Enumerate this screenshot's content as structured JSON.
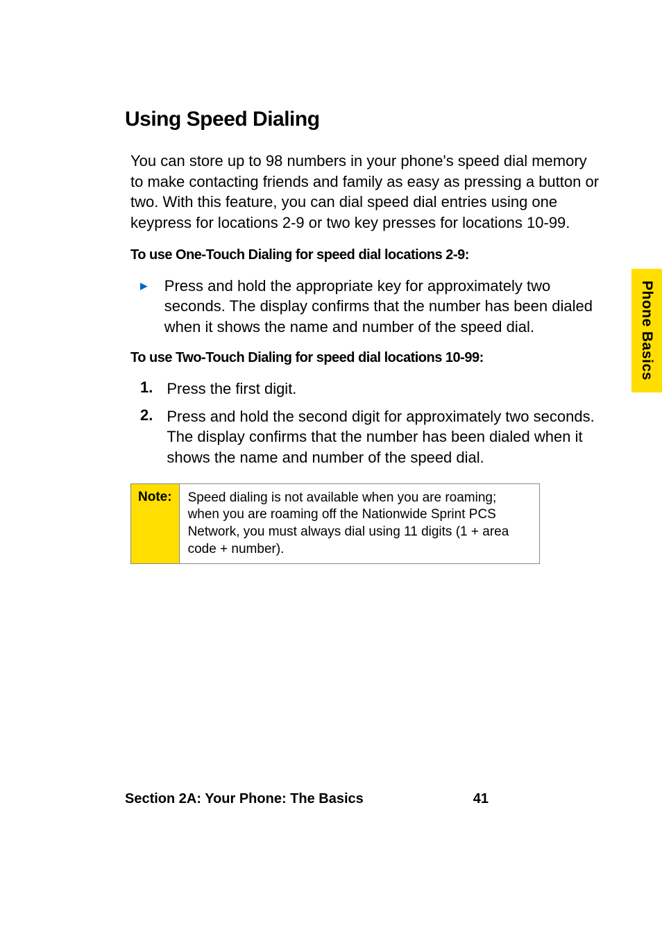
{
  "heading": "Using Speed Dialing",
  "intro": "You can store up to 98 numbers in your phone's speed dial memory to make contacting friends and family as easy as pressing a button or two. With this feature, you can dial speed dial entries using one keypress for locations 2-9 or two key presses for locations 10-99.",
  "subheading1": "To use One-Touch Dialing for speed dial locations 2-9:",
  "bullet1": "Press and hold the appropriate key for approximately two seconds. The display confirms that the number has been dialed when it shows the name and number of the speed dial.",
  "subheading2": "To use Two-Touch Dialing for speed dial locations 10-99:",
  "steps": [
    {
      "num": "1.",
      "text": "Press the first digit."
    },
    {
      "num": "2.",
      "text": "Press and hold the second digit for approximately two seconds. The display confirms that the number has been dialed when it shows the name and number of the speed dial."
    }
  ],
  "note": {
    "label": "Note:",
    "text": "Speed dialing is not available when you are roaming; when you are roaming off the Nationwide Sprint PCS Network, you must always dial using 11 digits (1 + area code + number)."
  },
  "sidetab": "Phone Basics",
  "footer": {
    "section": "Section 2A: Your Phone: The Basics",
    "page": "41"
  }
}
